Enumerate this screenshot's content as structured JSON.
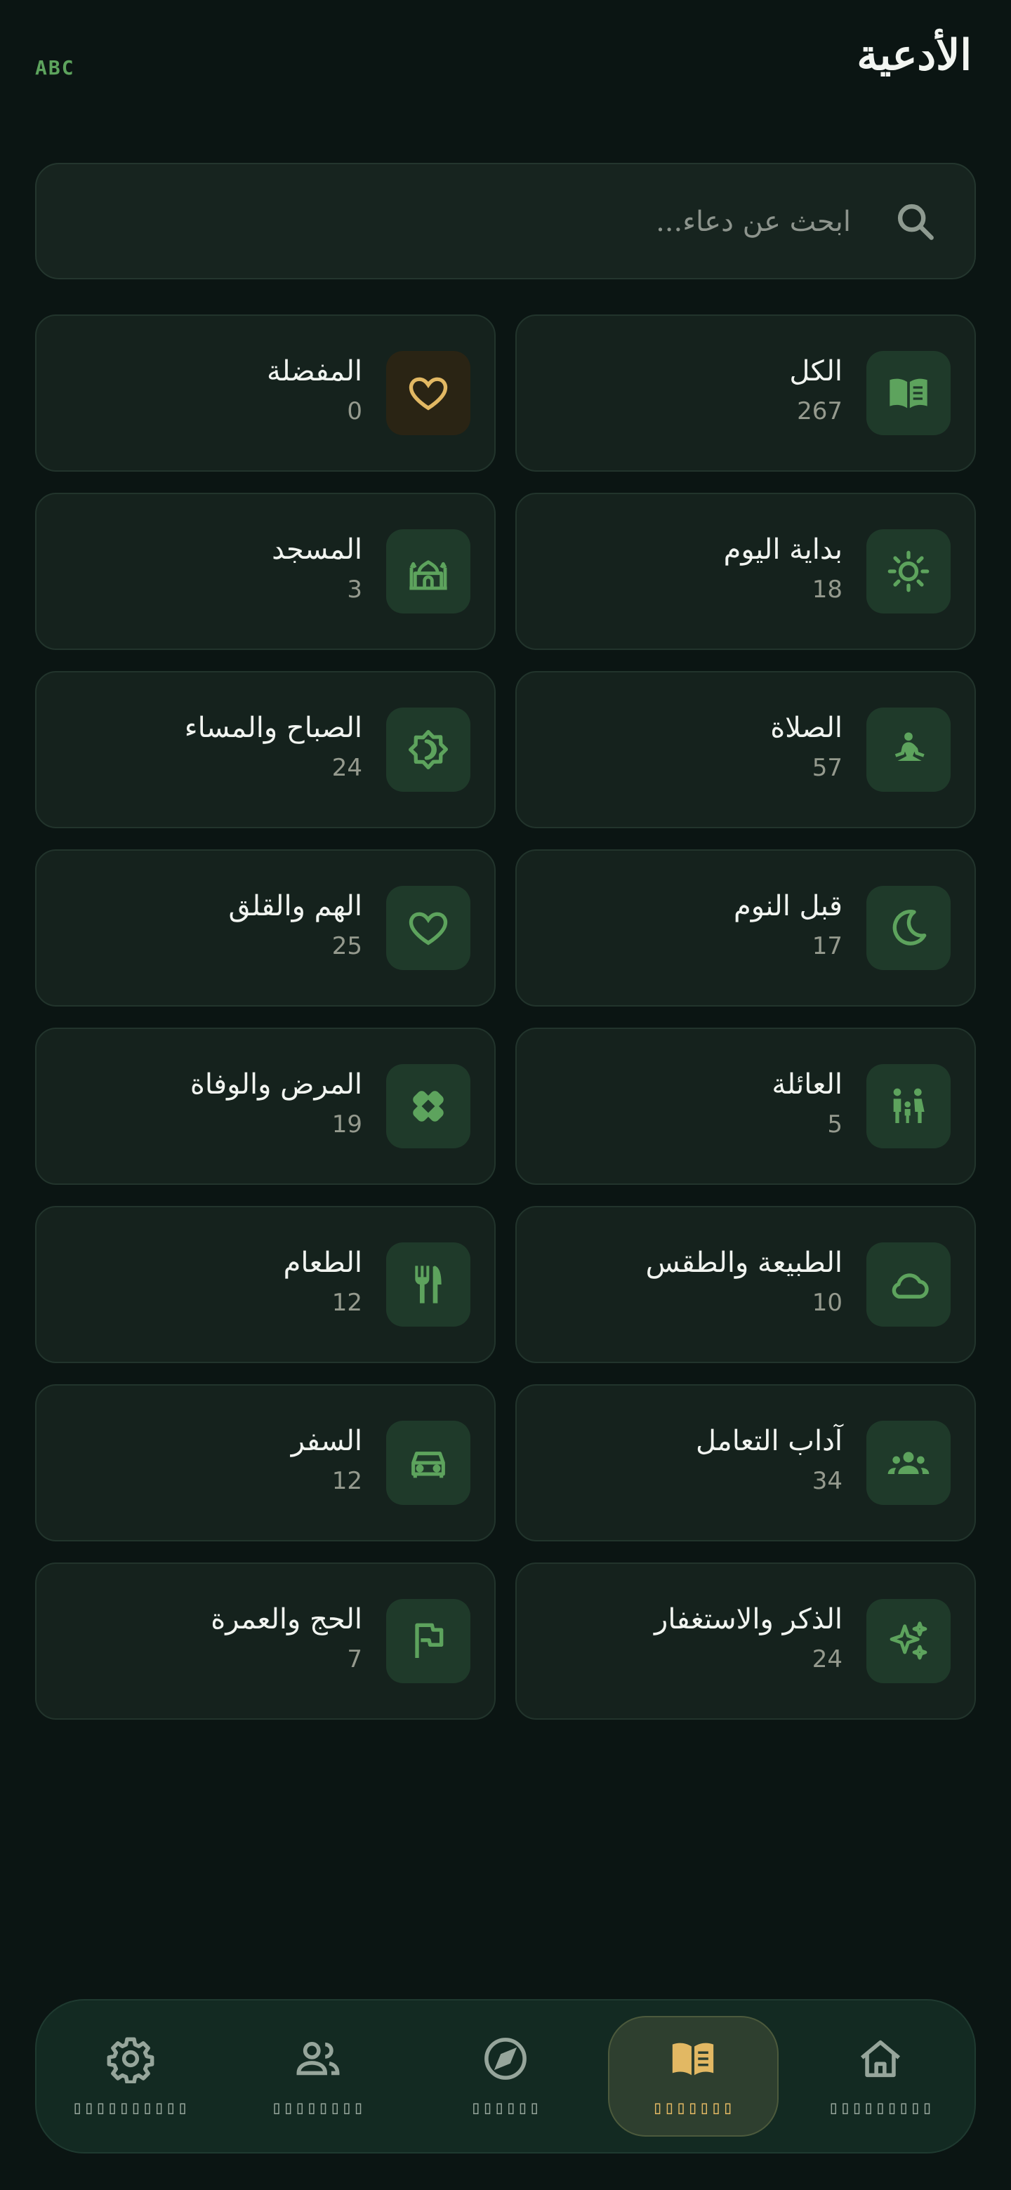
{
  "header": {
    "title": "الأدعية",
    "lang_button": "ABC"
  },
  "search": {
    "placeholder": "ابحث عن دعاء..."
  },
  "categories": [
    {
      "label": "الكل",
      "count": "267",
      "icon": "book-open-icon"
    },
    {
      "label": "المفضلة",
      "count": "0",
      "icon": "heart-outline-icon"
    },
    {
      "label": "بداية اليوم",
      "count": "18",
      "icon": "sun-icon"
    },
    {
      "label": "المسجد",
      "count": "3",
      "icon": "mosque-icon"
    },
    {
      "label": "الصلاة",
      "count": "57",
      "icon": "meditation-icon"
    },
    {
      "label": "الصباح والمساء",
      "count": "24",
      "icon": "day-night-icon"
    },
    {
      "label": "قبل النوم",
      "count": "17",
      "icon": "moon-icon"
    },
    {
      "label": "الهم والقلق",
      "count": "25",
      "icon": "heart-icon"
    },
    {
      "label": "العائلة",
      "count": "5",
      "icon": "family-icon"
    },
    {
      "label": "المرض والوفاة",
      "count": "19",
      "icon": "bandage-icon"
    },
    {
      "label": "الطبيعة والطقس",
      "count": "10",
      "icon": "cloud-icon"
    },
    {
      "label": "الطعام",
      "count": "12",
      "icon": "utensils-icon"
    },
    {
      "label": "آداب التعامل",
      "count": "34",
      "icon": "people-icon"
    },
    {
      "label": "السفر",
      "count": "12",
      "icon": "car-icon"
    },
    {
      "label": "الذكر والاستغفار",
      "count": "24",
      "icon": "sparkles-icon"
    },
    {
      "label": "الحج والعمرة",
      "count": "7",
      "icon": "flag-icon"
    }
  ],
  "nav": [
    {
      "label": "▯▯▯▯▯▯▯▯▯▯",
      "icon": "gear-icon",
      "active": false
    },
    {
      "label": "▯▯▯▯▯▯▯▯",
      "icon": "people-icon",
      "active": false
    },
    {
      "label": "▯▯▯▯▯▯",
      "icon": "compass-icon",
      "active": false
    },
    {
      "label": "▯▯▯▯▯▯▯",
      "icon": "book-icon",
      "active": true
    },
    {
      "label": "▯▯▯▯▯▯▯▯▯",
      "icon": "home-icon",
      "active": false
    }
  ],
  "colors": {
    "accent_green": "#5da35d",
    "accent_gold": "#e2b863",
    "background": "#0b1513"
  }
}
